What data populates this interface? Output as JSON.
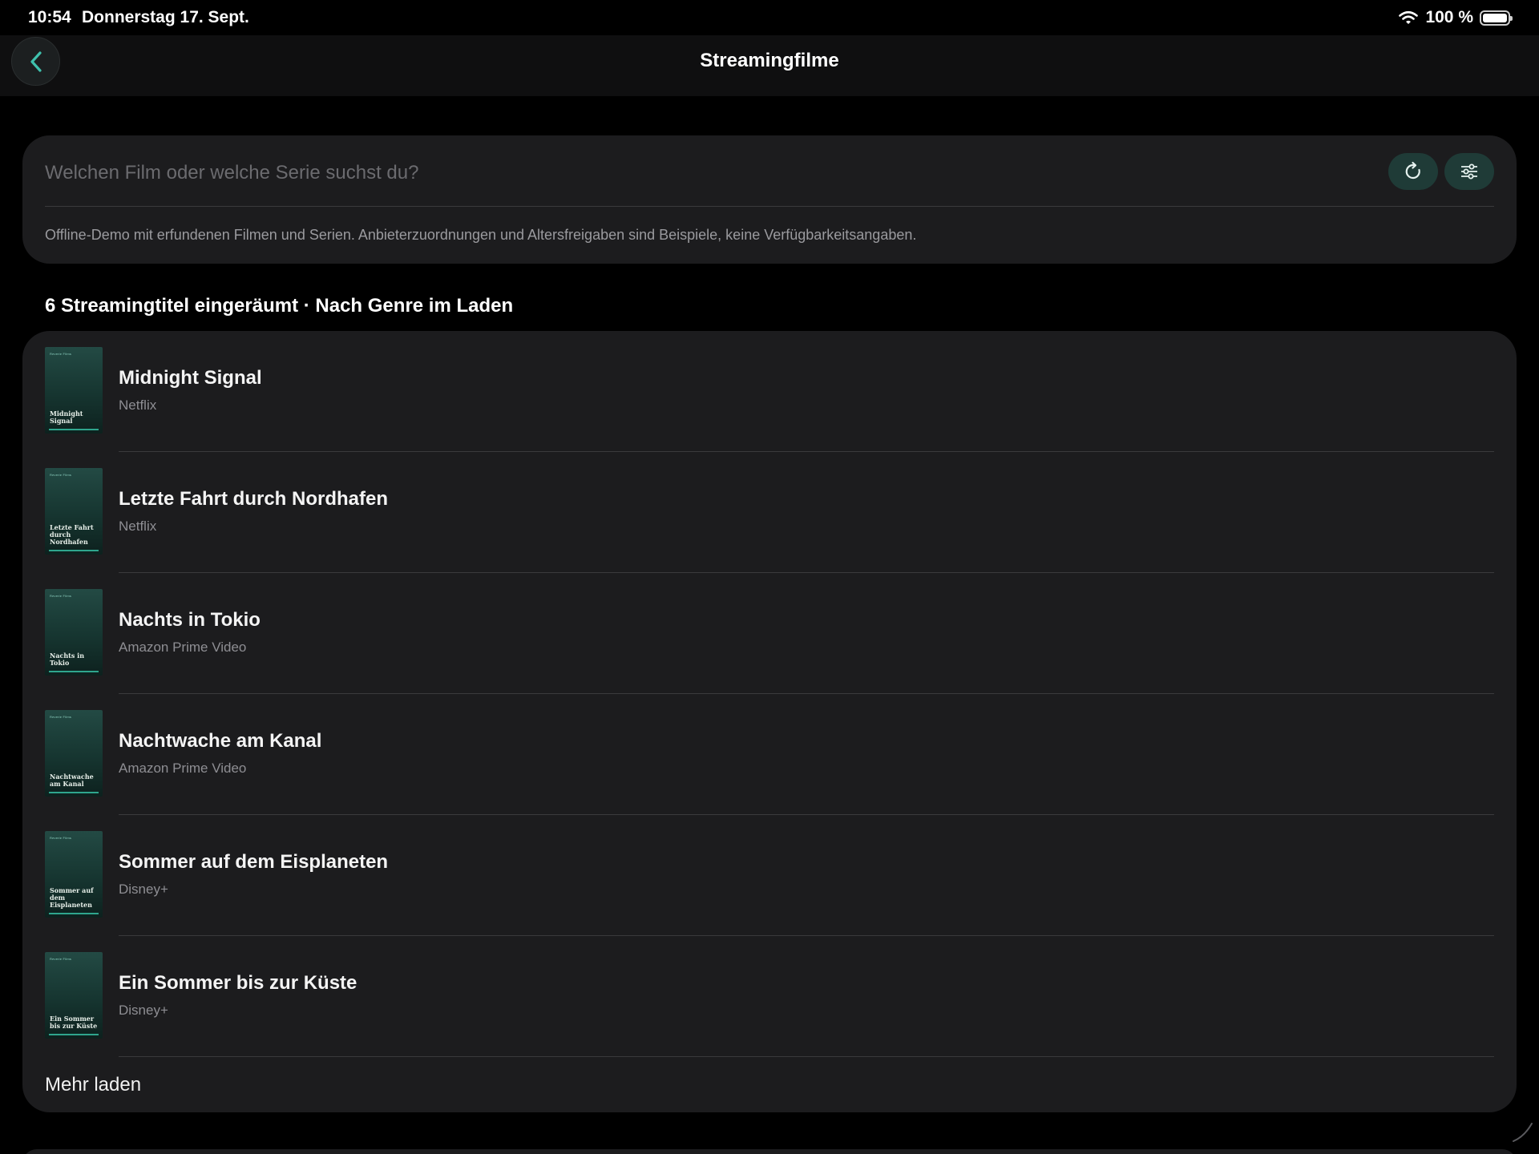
{
  "status": {
    "time": "10:54",
    "date": "Donnerstag 17. Sept.",
    "battery": "100 %"
  },
  "nav": {
    "title": "Streamingfilme"
  },
  "search": {
    "placeholder": "Welchen Film oder welche Serie suchst du?",
    "note": "Offline-Demo mit erfundenen Filmen und Serien. Anbieterzuordnungen und Altersfreigaben sind Beispiele, keine Verfügbarkeitsangaben."
  },
  "list": {
    "header": "6 Streamingtitel eingeräumt · Nach Genre im Laden",
    "poster_brand": "Reverie Films",
    "items": [
      {
        "title": "Midnight Signal",
        "provider": "Netflix",
        "poster_title": "Midnight Signal"
      },
      {
        "title": "Letzte Fahrt durch Nordhafen",
        "provider": "Netflix",
        "poster_title": "Letzte Fahrt durch Nordhafen"
      },
      {
        "title": "Nachts in Tokio",
        "provider": "Amazon Prime Video",
        "poster_title": "Nachts in Tokio"
      },
      {
        "title": "Nachtwache am Kanal",
        "provider": "Amazon Prime Video",
        "poster_title": "Nachtwache am Kanal"
      },
      {
        "title": "Sommer auf dem Eisplaneten",
        "provider": "Disney+",
        "poster_title": "Sommer auf dem Eisplaneten"
      },
      {
        "title": "Ein Sommer bis zur Küste",
        "provider": "Disney+",
        "poster_title": "Ein Sommer bis zur Küste"
      }
    ],
    "load_more": "Mehr laden"
  },
  "colors": {
    "accent": "#3fc1ad",
    "card": "#1c1c1e",
    "button_bg": "#1f3b37"
  },
  "icons": {
    "back": "chevron-left-icon",
    "refresh": "refresh-icon",
    "filter": "sliders-icon",
    "wifi": "wifi-icon",
    "battery": "battery-icon"
  }
}
